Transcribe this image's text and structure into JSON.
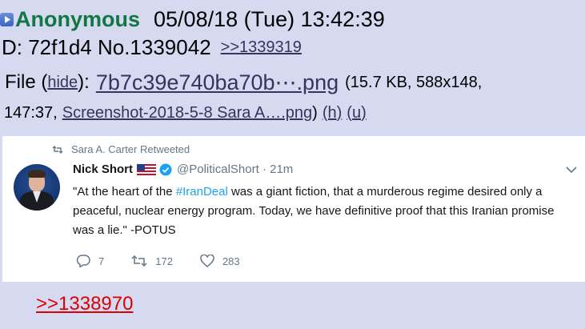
{
  "post": {
    "name": "Anonymous",
    "datetime": "05/08/18 (Tue) 13:42:39",
    "id_text": "D: 72f1d4 No.1339042",
    "reply_link": ">>1339319",
    "file_label": "File (",
    "hide_label": "hide",
    "file_label_close": "):",
    "filename": "7b7c39e740ba70b⋯.png",
    "file_meta": "(15.7 KB, 588x148,",
    "file_meta2": "147:37,",
    "original_filename": "Screenshot-2018-5-8 Sara A….png",
    "close_paren": ")",
    "h_link": "(h)",
    "u_link": "(u)",
    "bottom_reply": ">>1338970"
  },
  "tweet": {
    "retweeted_by": "Sara A. Carter Retweeted",
    "author_name": "Nick Short",
    "author_handle": "@PoliticalShort · 21m",
    "text_part1": "\"At the heart of the ",
    "hashtag": "#IranDeal",
    "text_part2": " was a giant fiction, that a murderous regime desired only a peaceful, nuclear energy program. Today, we have definitive proof that this Iranian promise was a lie.\" -POTUS",
    "reply_count": "7",
    "retweet_count": "172",
    "like_count": "283"
  },
  "colors": {
    "background": "#d6daf0",
    "name_green": "#117743",
    "link": "#34345c",
    "red_link": "#dd0000",
    "twitter_blue": "#1da1f2",
    "twitter_gray": "#657786"
  },
  "icons": [
    "expand-icon",
    "retweet-icon",
    "us-flag-icon",
    "verified-icon",
    "chevron-down-icon",
    "reply-icon",
    "like-icon"
  ]
}
